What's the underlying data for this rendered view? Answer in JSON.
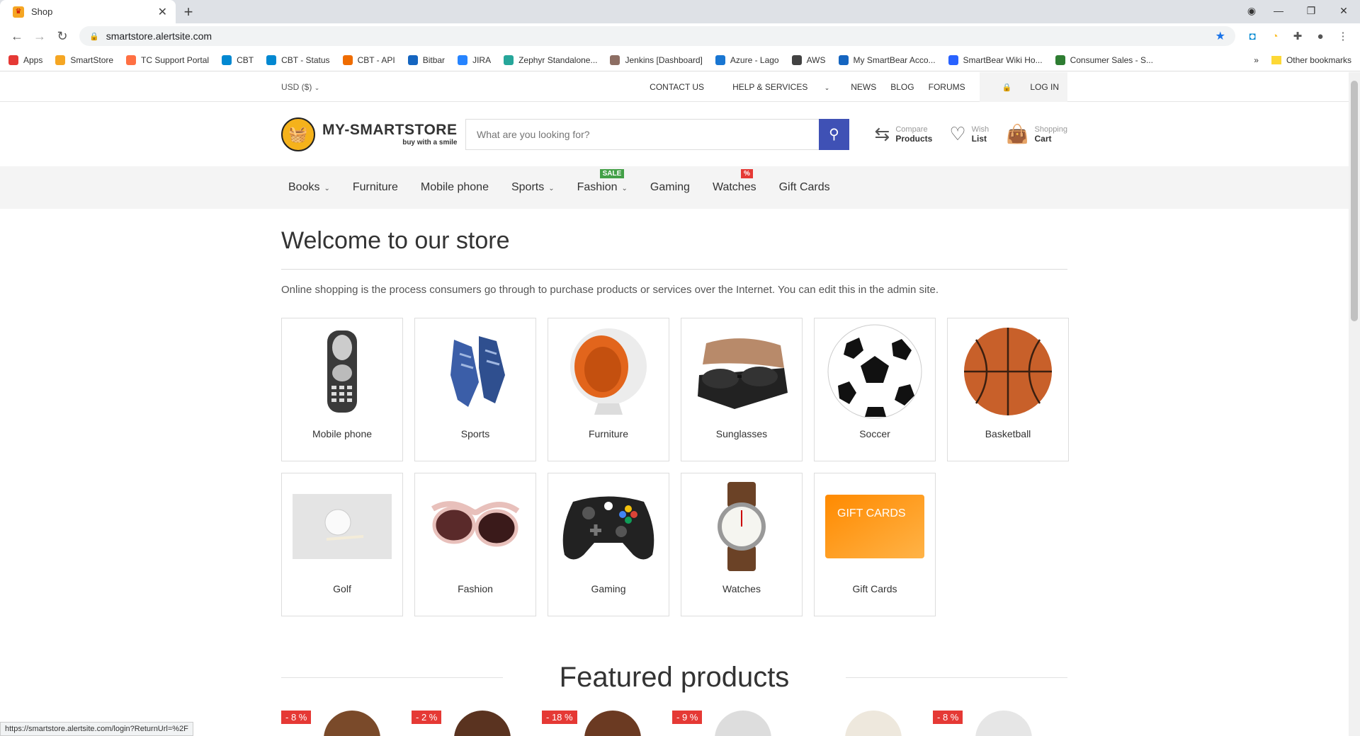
{
  "browser": {
    "tab_title": "Shop",
    "url": "smartstore.alertsite.com",
    "bookmarks": [
      {
        "label": "Apps",
        "color": "#e53935"
      },
      {
        "label": "SmartStore",
        "color": "#f5a623"
      },
      {
        "label": "TC Support Portal",
        "color": "#ff7043"
      },
      {
        "label": "CBT",
        "color": "#0288d1"
      },
      {
        "label": "CBT - Status",
        "color": "#0288d1"
      },
      {
        "label": "CBT - API",
        "color": "#ef6c00"
      },
      {
        "label": "Bitbar",
        "color": "#1565c0"
      },
      {
        "label": "JIRA",
        "color": "#2684ff"
      },
      {
        "label": "Zephyr Standalone...",
        "color": "#26a69a"
      },
      {
        "label": "Jenkins [Dashboard]",
        "color": "#8d6e63"
      },
      {
        "label": "Azure - Lago",
        "color": "#1976d2"
      },
      {
        "label": "AWS",
        "color": "#424242"
      },
      {
        "label": "My SmartBear Acco...",
        "color": "#1565c0"
      },
      {
        "label": "SmartBear Wiki Ho...",
        "color": "#2962ff"
      },
      {
        "label": "Consumer Sales - S...",
        "color": "#2e7d32"
      }
    ],
    "more_bookmarks": "»",
    "other_bookmarks": "Other bookmarks",
    "status_url": "https://smartstore.alertsite.com/login?ReturnUrl=%2F"
  },
  "topbar": {
    "currency": "USD ($)",
    "links": [
      "CONTACT US",
      "HELP & SERVICES",
      "NEWS",
      "BLOG",
      "FORUMS"
    ],
    "login": "LOG IN"
  },
  "header": {
    "logo_title": "MY-SMARTSTORE",
    "logo_slogan": "buy with a smile",
    "search_placeholder": "What are you looking for?",
    "compare_top": "Compare",
    "compare_bottom": "Products",
    "wish_top": "Wish",
    "wish_bottom": "List",
    "cart_top": "Shopping",
    "cart_bottom": "Cart"
  },
  "nav": {
    "items": [
      {
        "label": "Books",
        "dropdown": true
      },
      {
        "label": "Furniture",
        "dropdown": false
      },
      {
        "label": "Mobile phone",
        "dropdown": false
      },
      {
        "label": "Sports",
        "dropdown": true
      },
      {
        "label": "Fashion",
        "dropdown": true,
        "badge": "SALE",
        "badge_color": "#43a047"
      },
      {
        "label": "Gaming",
        "dropdown": false
      },
      {
        "label": "Watches",
        "dropdown": false,
        "badge": "%",
        "badge_color": "#e53935"
      },
      {
        "label": "Gift Cards",
        "dropdown": false
      }
    ]
  },
  "main": {
    "title": "Welcome to our store",
    "intro": "Online shopping is the process consumers go through to purchase products or services over the Internet. You can edit this in the admin site.",
    "categories": [
      {
        "label": "Mobile phone",
        "icon": "mobile-phone"
      },
      {
        "label": "Sports",
        "icon": "sneakers"
      },
      {
        "label": "Furniture",
        "icon": "ball-chair"
      },
      {
        "label": "Sunglasses",
        "icon": "sunglasses"
      },
      {
        "label": "Soccer",
        "icon": "soccer-ball"
      },
      {
        "label": "Basketball",
        "icon": "basketball"
      },
      {
        "label": "Golf",
        "icon": "golf-ball"
      },
      {
        "label": "Fashion",
        "icon": "fashion-glasses"
      },
      {
        "label": "Gaming",
        "icon": "game-controller"
      },
      {
        "label": "Watches",
        "icon": "wristwatch"
      },
      {
        "label": "Gift Cards",
        "icon": "gift-card",
        "card_text": "GIFT CARDS"
      }
    ],
    "featured_title": "Featured products",
    "featured_discounts": [
      "- 8 %",
      "- 2 %",
      "- 18 %",
      "- 9 %",
      "",
      "- 8 %"
    ]
  }
}
